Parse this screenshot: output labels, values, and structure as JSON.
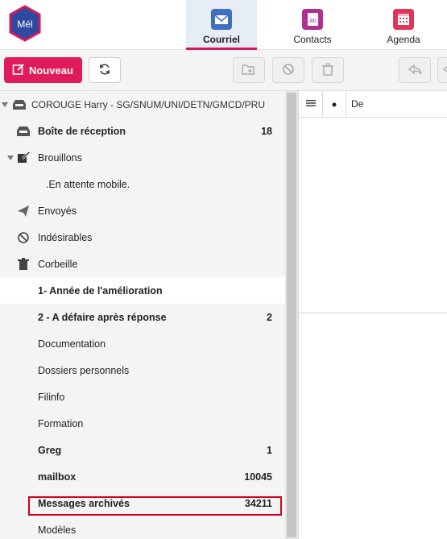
{
  "app": {
    "logo_text": "Mél"
  },
  "nav": {
    "tabs": [
      {
        "label": "Courriel",
        "active": true,
        "icon": "mail-icon",
        "color": "#3f6fbf"
      },
      {
        "label": "Contacts",
        "active": false,
        "icon": "contacts-icon",
        "color": "#b0308f"
      },
      {
        "label": "Agenda",
        "active": false,
        "icon": "calendar-icon",
        "color": "#e0345a"
      }
    ]
  },
  "toolbar": {
    "new_label": "Nouveau",
    "accent_color": "#e01b59",
    "buttons": [
      {
        "name": "refresh-button",
        "icon": "refresh-icon",
        "enabled": true
      },
      {
        "name": "move-button",
        "icon": "move-folder-icon",
        "enabled": false
      },
      {
        "name": "spam-button",
        "icon": "block-icon",
        "enabled": false
      },
      {
        "name": "delete-button",
        "icon": "trash-icon",
        "enabled": false
      },
      {
        "name": "reply-button",
        "icon": "reply-icon",
        "enabled": false
      }
    ]
  },
  "account": {
    "label": "COROUGE Harry - SG/SNUM/UNI/DETN/GMCD/PRU"
  },
  "folders": [
    {
      "name": "Boîte de réception",
      "count": "18",
      "bold": true,
      "icon": "inbox-icon"
    },
    {
      "name": "Brouillons",
      "count": "",
      "bold": false,
      "icon": "drafts-icon"
    },
    {
      "name": ".En attente mobile.",
      "count": "",
      "bold": false,
      "icon": ""
    },
    {
      "name": "Envoyés",
      "count": "",
      "bold": false,
      "icon": "send-icon"
    },
    {
      "name": "Indésirables",
      "count": "",
      "bold": false,
      "icon": "block-icon"
    },
    {
      "name": "Corbeille",
      "count": "",
      "bold": false,
      "icon": "trash-icon"
    },
    {
      "name": "1- Année de l'amélioration",
      "count": "",
      "bold": true,
      "icon": ""
    },
    {
      "name": "2 - A défaire après réponse",
      "count": "2",
      "bold": true,
      "icon": ""
    },
    {
      "name": "Documentation",
      "count": "",
      "bold": false,
      "icon": ""
    },
    {
      "name": "Dossiers personnels",
      "count": "",
      "bold": false,
      "icon": ""
    },
    {
      "name": "Filinfo",
      "count": "",
      "bold": false,
      "icon": ""
    },
    {
      "name": "Formation",
      "count": "",
      "bold": false,
      "icon": ""
    },
    {
      "name": "Greg",
      "count": "1",
      "bold": true,
      "icon": ""
    },
    {
      "name": "mailbox",
      "count": "10045",
      "bold": true,
      "icon": ""
    },
    {
      "name": "Messages archivés",
      "count": "34211",
      "bold": true,
      "icon": ""
    },
    {
      "name": "Modèles",
      "count": "",
      "bold": false,
      "icon": ""
    }
  ],
  "message_list": {
    "col_from": "De"
  }
}
